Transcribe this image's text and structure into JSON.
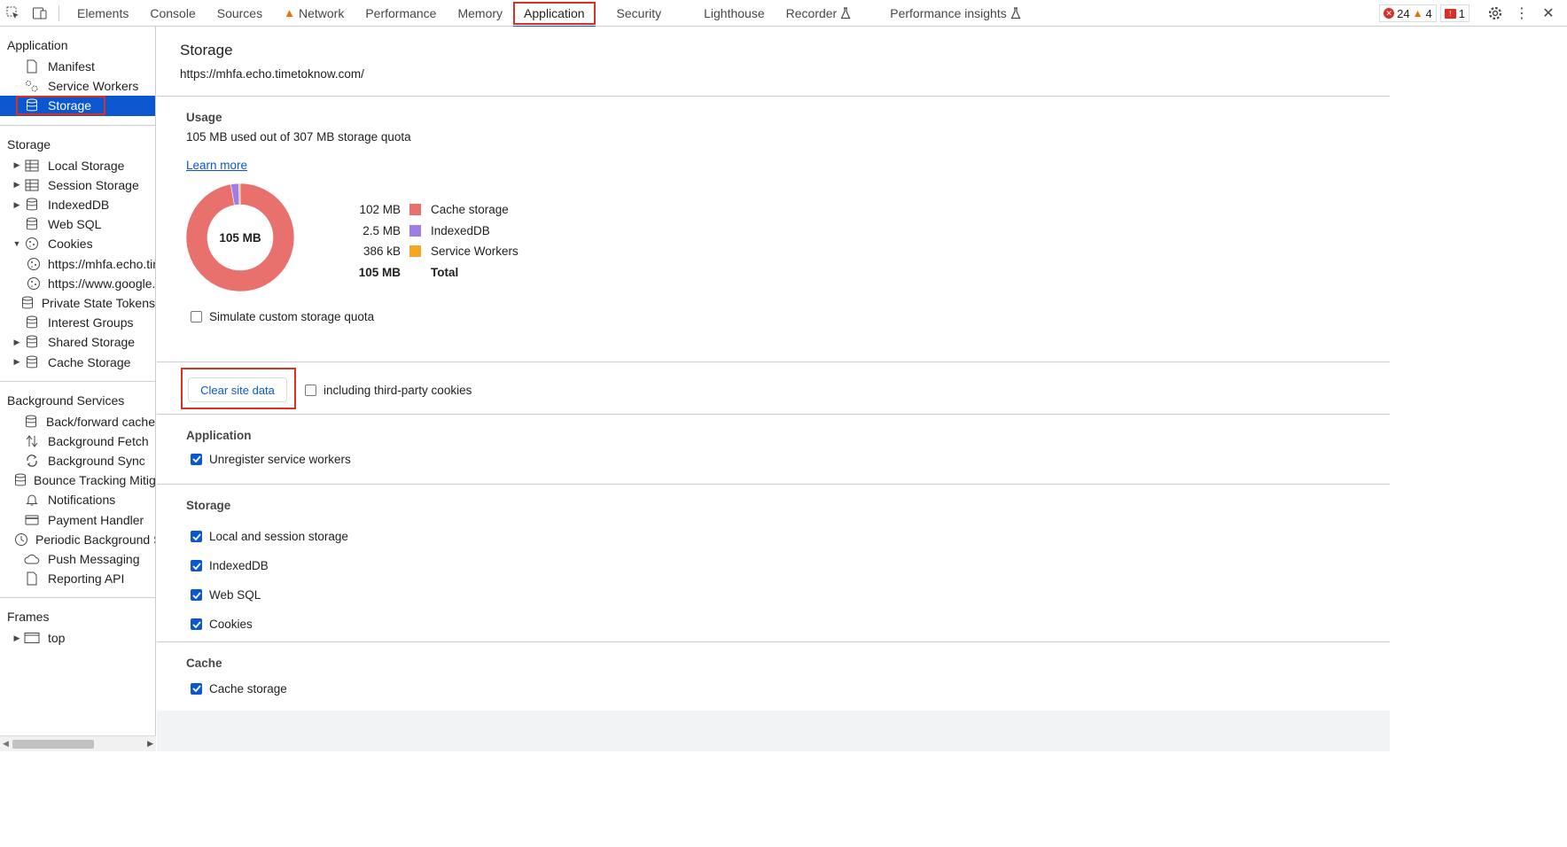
{
  "toolbar": {
    "tabs": [
      {
        "label": "Elements"
      },
      {
        "label": "Console"
      },
      {
        "label": "Sources"
      },
      {
        "label": "Network"
      },
      {
        "label": "Performance"
      },
      {
        "label": "Memory"
      },
      {
        "label": "Application"
      },
      {
        "label": "Security"
      },
      {
        "label": "Lighthouse"
      },
      {
        "label": "Recorder"
      },
      {
        "label": "Performance insights"
      }
    ],
    "errors_count": "24",
    "warnings_count": "4",
    "issues_count": "1"
  },
  "sidebar": {
    "application_title": "Application",
    "application_items": [
      "Manifest",
      "Service Workers",
      "Storage"
    ],
    "storage_title": "Storage",
    "storage_items": [
      "Local Storage",
      "Session Storage",
      "IndexedDB",
      "Web SQL",
      "Cookies",
      "https://mhfa.echo.timetoknow.com",
      "https://www.google.com",
      "Private State Tokens",
      "Interest Groups",
      "Shared Storage",
      "Cache Storage"
    ],
    "background_title": "Background Services",
    "background_items": [
      "Back/forward cache",
      "Background Fetch",
      "Background Sync",
      "Bounce Tracking Mitigations",
      "Notifications",
      "Payment Handler",
      "Periodic Background Sync",
      "Push Messaging",
      "Reporting API"
    ],
    "frames_title": "Frames",
    "frames_items": [
      "top"
    ]
  },
  "main": {
    "title": "Storage",
    "origin": "https://mhfa.echo.timetoknow.com/",
    "usage": {
      "title": "Usage",
      "summary": "105 MB used out of 307 MB storage quota",
      "learn_more": "Learn more",
      "donut_label": "105 MB",
      "legend": [
        {
          "value": "102 MB",
          "label": "Cache storage",
          "color": "#e8716d",
          "fraction": 0.972
        },
        {
          "value": "2.5 MB",
          "label": "IndexedDB",
          "color": "#a07de6",
          "fraction": 0.024
        },
        {
          "value": "386 kB",
          "label": "Service Workers",
          "color": "#f5a623",
          "fraction": 0.004
        }
      ],
      "total_value": "105 MB",
      "total_label": "Total",
      "simulate_label": "Simulate custom storage quota"
    },
    "clear_button": "Clear site data",
    "third_party_label": "including third-party cookies",
    "application_section": {
      "title": "Application",
      "items": [
        "Unregister service workers"
      ]
    },
    "storage_section": {
      "title": "Storage",
      "items": [
        "Local and session storage",
        "IndexedDB",
        "Web SQL",
        "Cookies"
      ]
    },
    "cache_section": {
      "title": "Cache",
      "items": [
        "Cache storage"
      ]
    }
  }
}
